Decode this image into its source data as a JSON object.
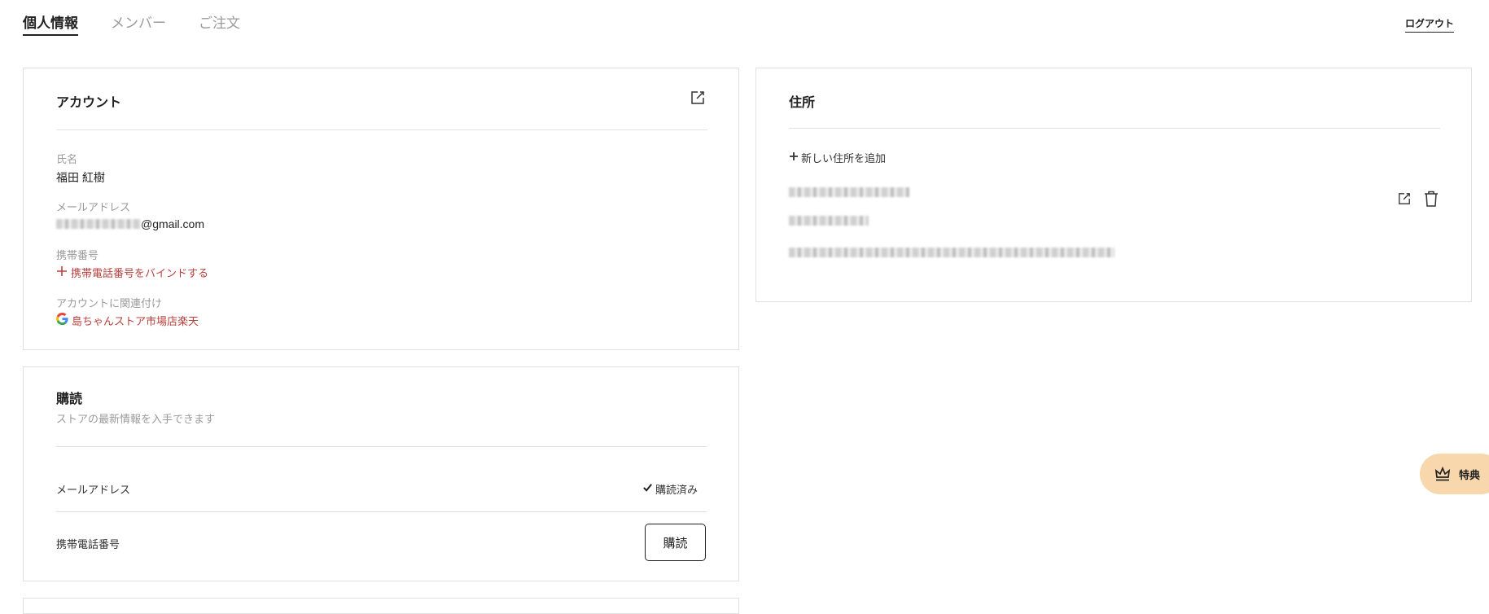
{
  "tabs": [
    {
      "label": "個人情報",
      "active": true
    },
    {
      "label": "メンバー",
      "active": false
    },
    {
      "label": "ご注文",
      "active": false
    }
  ],
  "logout_label": "ログアウト",
  "account": {
    "title": "アカウント",
    "name_label": "氏名",
    "name_value": "福田 紅樹",
    "email_label": "メールアドレス",
    "email_value_suffix": "@gmail.com",
    "phone_label": "携帯番号",
    "phone_bind_link": "携帯電話番号をバインドする",
    "linked_label": "アカウントに関連付け",
    "linked_value": "島ちゃんストア市場店楽天",
    "icons": {
      "edit": "edit-icon",
      "google": "google-icon",
      "plus": "plus-icon"
    }
  },
  "address": {
    "title": "住所",
    "add_link": "新しい住所を追加",
    "icons": {
      "edit": "edit-icon",
      "delete": "trash-icon"
    }
  },
  "subscription": {
    "title": "購読",
    "subtitle": "ストアの最新情報を入手できます",
    "email_label": "メールアドレス",
    "email_status": "購読済み",
    "phone_label": "携帯電話番号",
    "subscribe_button": "購読"
  },
  "perk_button": {
    "label": "特典",
    "icon": "crown-icon"
  },
  "colors": {
    "accent_red": "#b9403c",
    "perk_bg": "#f7d7ab",
    "border": "#e1e1e1",
    "muted_text": "#9a9a9a"
  }
}
